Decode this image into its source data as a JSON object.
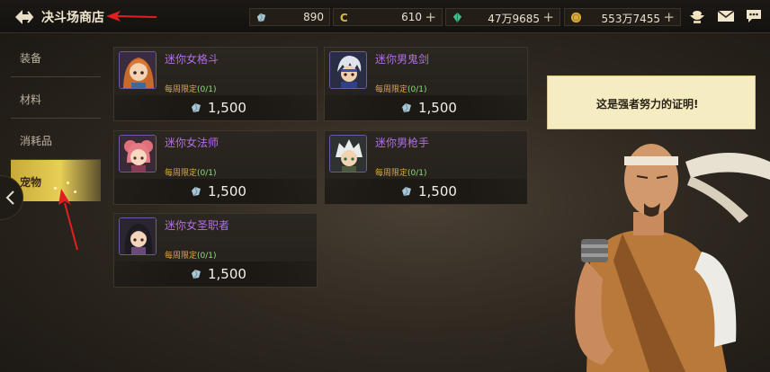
{
  "header": {
    "title": "决斗场商店"
  },
  "resources": [
    {
      "icon": "crystal-icon",
      "value": "890",
      "has_plus": false
    },
    {
      "icon": "coin-c-icon",
      "value": "610",
      "has_plus": true
    },
    {
      "icon": "green-gem-icon",
      "value": "47万9685",
      "has_plus": true
    },
    {
      "icon": "gold-coin-icon",
      "value": "553万7455",
      "has_plus": true
    }
  ],
  "plus_label": "+",
  "top_icons": [
    "treasure-bowl-icon",
    "mail-icon",
    "chat-icon"
  ],
  "sidebar": {
    "items": [
      {
        "label": "装备",
        "active": false
      },
      {
        "label": "材料",
        "active": false
      },
      {
        "label": "消耗品",
        "active": false
      },
      {
        "label": "宠物",
        "active": true
      }
    ]
  },
  "shop": {
    "items": [
      {
        "name": "迷你女格斗",
        "limit_label": "每周限定",
        "limit_count": "(0/1)",
        "price": "1,500",
        "currency_icon": "crystal-icon"
      },
      {
        "name": "迷你男鬼剑",
        "limit_label": "每周限定",
        "limit_count": "(0/1)",
        "price": "1,500",
        "currency_icon": "crystal-icon"
      },
      {
        "name": "迷你女法师",
        "limit_label": "每周限定",
        "limit_count": "(0/1)",
        "price": "1,500",
        "currency_icon": "crystal-icon"
      },
      {
        "name": "迷你男枪手",
        "limit_label": "每周限定",
        "limit_count": "(0/1)",
        "price": "1,500",
        "currency_icon": "crystal-icon"
      },
      {
        "name": "迷你女圣职者",
        "limit_label": "每周限定",
        "limit_count": "(0/1)",
        "price": "1,500",
        "currency_icon": "crystal-icon"
      }
    ]
  },
  "npc": {
    "speech": "这是强者努力的证明!"
  },
  "colors": {
    "accent_gold": "#e8cf56",
    "item_name": "#b06ee6",
    "limit_text": "#d9a74c",
    "annotation_red": "#e02020"
  }
}
